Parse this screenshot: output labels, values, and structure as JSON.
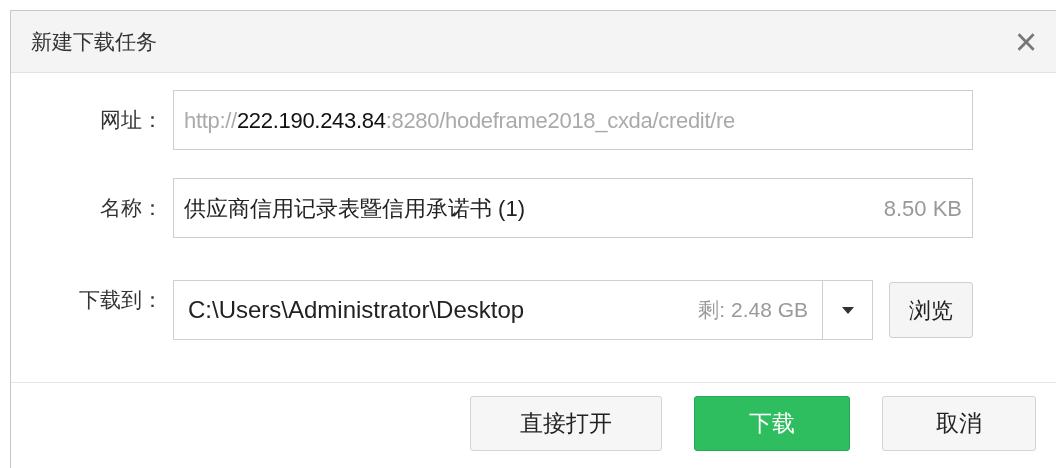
{
  "window": {
    "title": "新建下载任务",
    "close": "×"
  },
  "url": {
    "label": "网址：",
    "scheme": "http://",
    "host": "222.190.243.84",
    "rest": ":8280/hodeframe2018_cxda/credit/re"
  },
  "name": {
    "label": "名称：",
    "value": "供应商信用记录表暨信用承诺书 (1)",
    "size": "8.50 KB"
  },
  "save_to": {
    "label": "下载到：",
    "value": "C:\\Users\\Administrator\\Desktop",
    "free": "剩: 2.48 GB",
    "browse": "浏览"
  },
  "buttons": [
    {
      "label": "直接打开",
      "kind": "secondary"
    },
    {
      "label": "下载",
      "kind": "primary"
    },
    {
      "label": "取消",
      "kind": "secondary"
    }
  ]
}
